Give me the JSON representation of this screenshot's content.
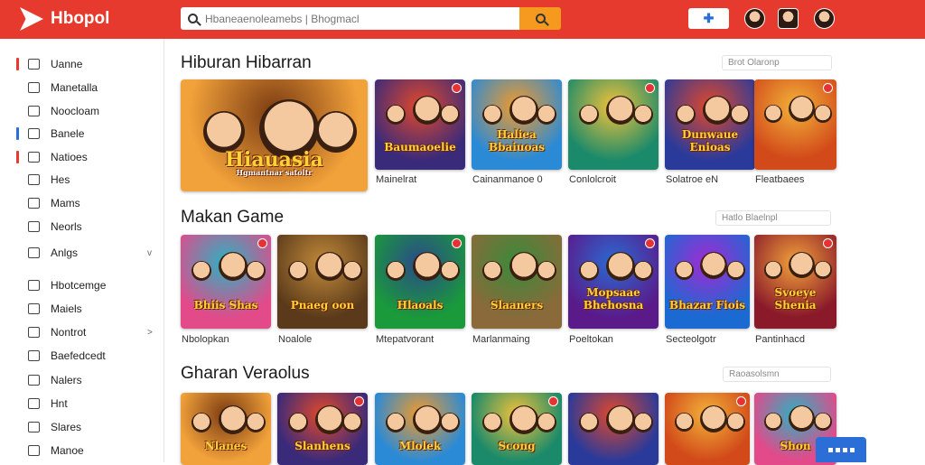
{
  "header": {
    "brand": "Hbopol",
    "search_placeholder": "Hbaneaenoleamebs | Bhogmacl",
    "accent": "#e63a2e",
    "search_button_color": "#f59a1f"
  },
  "sidebar": {
    "items": [
      {
        "label": "Uanne",
        "icon": "bookmark-icon",
        "accent": "#e63a2e"
      },
      {
        "label": "Manetalla",
        "icon": "folder-icon",
        "accent": ""
      },
      {
        "label": "Noocloam",
        "icon": "window-icon",
        "accent": ""
      },
      {
        "label": "Banele",
        "icon": "person-icon",
        "accent": "#2a6fd6"
      },
      {
        "label": "Natioes",
        "icon": "list-icon",
        "accent": "#e63a2e"
      },
      {
        "label": "Hes",
        "icon": "chat-icon",
        "accent": ""
      },
      {
        "label": "Mams",
        "icon": "doc-icon",
        "accent": ""
      },
      {
        "label": "Neorls",
        "icon": "refresh-icon",
        "accent": ""
      },
      {
        "label": "Anlgs",
        "icon": "diamond-icon",
        "accent": "",
        "chevron": "v"
      },
      {
        "label": "Hbotcemge",
        "icon": "clipboard-icon",
        "accent": ""
      },
      {
        "label": "Maiels",
        "icon": "check-icon",
        "accent": ""
      },
      {
        "label": "Nontrot",
        "icon": "document-icon",
        "accent": "",
        "chevron": ">"
      },
      {
        "label": "Baefedcedt",
        "icon": "calendar-icon",
        "accent": ""
      },
      {
        "label": "Nalers",
        "icon": "minus-box-icon",
        "accent": ""
      },
      {
        "label": "Hnt",
        "icon": "file-icon",
        "accent": ""
      },
      {
        "label": "Slares",
        "icon": "bars-icon",
        "accent": ""
      },
      {
        "label": "Manoe",
        "icon": "tag-icon",
        "accent": ""
      }
    ]
  },
  "sections": [
    {
      "title": "Hiburan Hibarran",
      "filter": "Brot Olaronp",
      "cards": [
        {
          "label": "",
          "art": "Hiauasia",
          "subtitle": "Hgmantnar satoltr"
        },
        {
          "label": "Mainelrat",
          "art": "Baumaoelie"
        },
        {
          "label": "Cainanmanoe 0",
          "art": "Haliea Bbaiuoas"
        },
        {
          "label": "Conlolcroit",
          "art": ""
        },
        {
          "label": "Solatroe eN",
          "art": "Dunwaue Enioas"
        },
        {
          "label": "Fleatbaees",
          "art": ""
        }
      ]
    },
    {
      "title": "Makan Game",
      "filter": "Hatlo Blaelnpl",
      "cards": [
        {
          "label": "Nbolopkan",
          "art": "Bhiis Shas"
        },
        {
          "label": "Noalole",
          "art": "Pnaeg oon"
        },
        {
          "label": "Mtepatvorant",
          "art": "Hlaoals"
        },
        {
          "label": "Marlanmaing",
          "art": "Slaaners"
        },
        {
          "label": "Poeltokan",
          "art": "Mopsaae Bhehosna"
        },
        {
          "label": "Secteolgotr",
          "art": "Bhazar Fiois"
        },
        {
          "label": "Pantinhacd",
          "art": "Svoeye Shenia"
        }
      ]
    },
    {
      "title": "Gharan Veraolus",
      "filter": "Raoasolsmn",
      "cards": [
        {
          "label": "",
          "art": "Nlanes"
        },
        {
          "label": "",
          "art": "Slanhens"
        },
        {
          "label": "",
          "art": "Mlolek"
        },
        {
          "label": "",
          "art": "Scong"
        },
        {
          "label": "",
          "art": ""
        },
        {
          "label": "",
          "art": ""
        },
        {
          "label": "",
          "art": "Shon"
        }
      ]
    }
  ]
}
